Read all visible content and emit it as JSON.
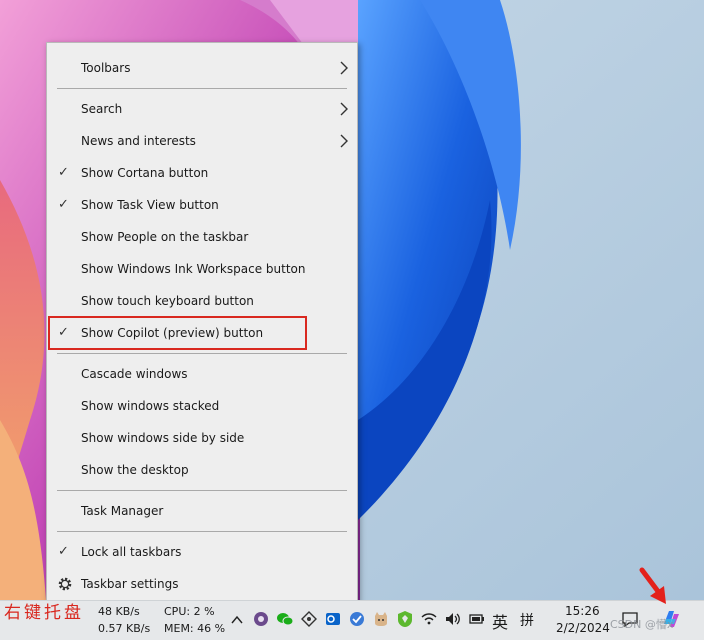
{
  "menu": {
    "items": [
      {
        "label": "Toolbars",
        "check": "",
        "arrow": true
      },
      {
        "label": "Search",
        "check": "",
        "arrow": true
      },
      {
        "label": "News and interests",
        "check": "",
        "arrow": true
      },
      {
        "label": "Show Cortana button",
        "check": "✓",
        "arrow": false
      },
      {
        "label": "Show Task View button",
        "check": "✓",
        "arrow": false
      },
      {
        "label": "Show People on the taskbar",
        "check": "",
        "arrow": false
      },
      {
        "label": "Show Windows Ink Workspace button",
        "check": "",
        "arrow": false
      },
      {
        "label": "Show touch keyboard button",
        "check": "",
        "arrow": false
      },
      {
        "label": "Show Copilot (preview) button",
        "check": "✓",
        "arrow": false
      },
      {
        "label": "Cascade windows",
        "check": "",
        "arrow": false
      },
      {
        "label": "Show windows stacked",
        "check": "",
        "arrow": false
      },
      {
        "label": "Show windows side by side",
        "check": "",
        "arrow": false
      },
      {
        "label": "Show the desktop",
        "check": "",
        "arrow": false
      },
      {
        "label": "Task Manager",
        "check": "",
        "arrow": false
      },
      {
        "label": "Lock all taskbars",
        "check": "✓",
        "arrow": false
      },
      {
        "label": "Taskbar settings",
        "check": "",
        "arrow": false
      }
    ]
  },
  "annotation": {
    "caption": "右键托盘"
  },
  "taskbar": {
    "net_up": "48 KB/s",
    "net_down": "0.57 KB/s",
    "cpu": "CPU: 2 %",
    "mem": "MEM: 46 %",
    "ime_lang": "英",
    "ime_mode": "拼",
    "time": "15:26",
    "date": "2/2/2024"
  },
  "watermark": {
    "text": "CSDN @懵x"
  },
  "colors": {
    "menu_bg": "#eeeeee",
    "highlight": "#d9281f",
    "accent": "#0a5bd4"
  }
}
